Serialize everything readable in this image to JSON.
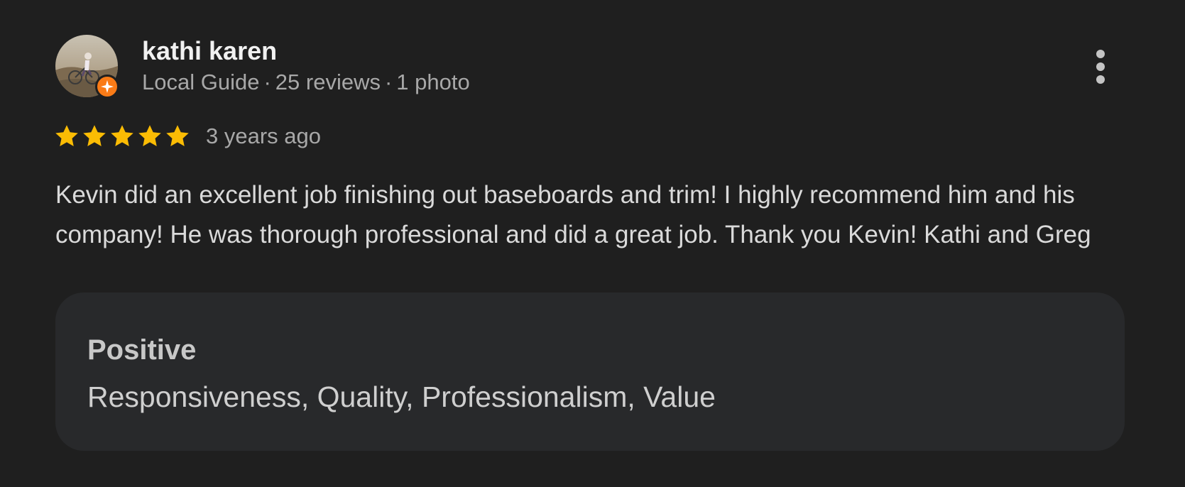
{
  "reviewer": {
    "name": "kathi karen",
    "level": "Local Guide",
    "review_count": "25 reviews",
    "photo_count": "1 photo",
    "separator": "·",
    "avatar_icon": "avatar-photo",
    "badge_icon": "local-guide-badge-icon"
  },
  "review": {
    "rating": 5,
    "rating_max": 5,
    "date": "3 years ago",
    "text": "Kevin did an excellent job finishing out baseboards and trim! I highly recommend him and his company! He was thorough professional and did a great job. Thank you Kevin! Kathi and Greg"
  },
  "attributes": {
    "title": "Positive",
    "values": "Responsiveness, Quality, Professionalism, Value"
  },
  "menu": {
    "icon": "more-vert-icon"
  },
  "colors": {
    "background": "#1f1f1f",
    "card": "#28292b",
    "star": "#fbbc04",
    "badge": "#fa7b17"
  }
}
